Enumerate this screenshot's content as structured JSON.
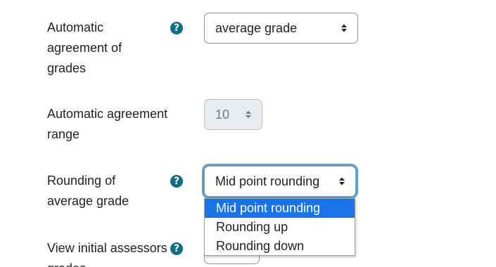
{
  "fields": [
    {
      "label_lines": [
        "Automatic",
        "agreement of",
        "grades"
      ],
      "help_icon": "help-icon",
      "select_value": "average grade"
    },
    {
      "label_lines": [
        "Automatic agreement",
        "range"
      ],
      "select_value": "10",
      "disabled": true
    },
    {
      "label_lines": [
        "Rounding of",
        "average grade"
      ],
      "help_icon": "help-icon",
      "select_value": "Mid point rounding",
      "focused": true,
      "options": [
        "Mid point rounding",
        "Rounding up",
        "Rounding down"
      ],
      "highlighted_option": "Mid point rounding"
    },
    {
      "label_lines": [
        "View initial assessors",
        "grades"
      ],
      "help_icon": "help-icon"
    }
  ],
  "help_glyph": "?",
  "colors": {
    "help_icon": "#0f6e84",
    "focus_ring": "#5b9fd1",
    "option_highlight": "#1a73e8",
    "disabled_bg": "#e9ecef"
  }
}
